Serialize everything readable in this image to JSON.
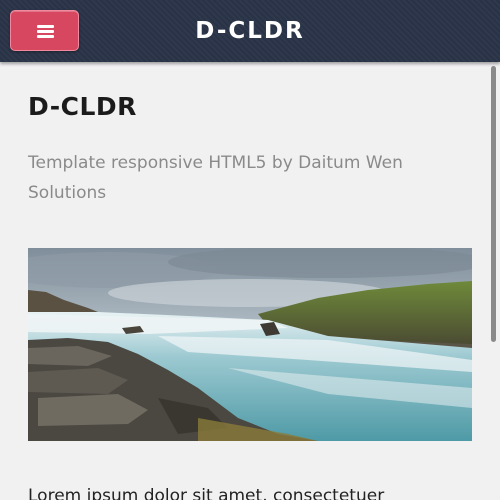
{
  "header": {
    "brand": "D-CLDR",
    "menu_icon": "hamburger-menu-icon",
    "background_color": "#2a3448",
    "accent_color": "#d7475f"
  },
  "main": {
    "title": "D-CLDR",
    "subtitle": "Template responsive HTML5 by Daitum Wen Solutions",
    "hero_image_description": "waterfall landscape photo",
    "body_text": "Lorem ipsum dolor sit amet, consectetuer"
  }
}
